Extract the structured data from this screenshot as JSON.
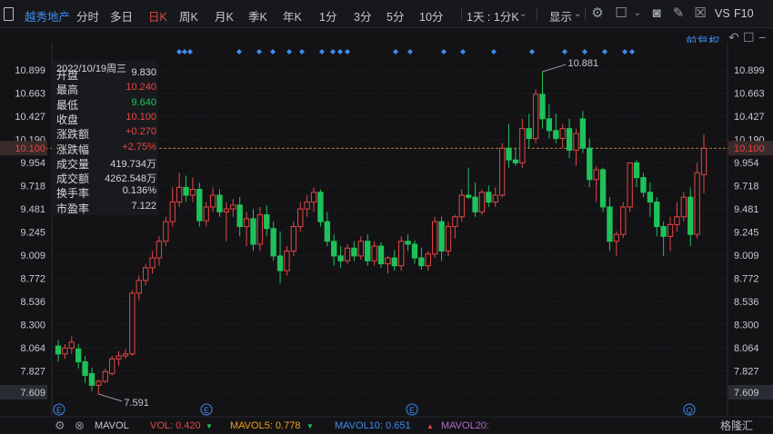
{
  "toolbar": {
    "stock_name": "越秀地产",
    "periods": [
      "分时",
      "多日",
      "日K",
      "周K",
      "月K",
      "季K",
      "年K",
      "1分",
      "3分",
      "5分",
      "10分"
    ],
    "active_period": "日K",
    "dual_period": "1天 : 1分K",
    "display_label": "显示",
    "vs_label": "VS",
    "f10_label": "F10"
  },
  "restore_label": "前复权",
  "info_panel": {
    "date": "2022/10/19周三",
    "rows": [
      {
        "label": "开盘",
        "value": "9.830",
        "color": "neutral"
      },
      {
        "label": "最高",
        "value": "10.240",
        "color": "up"
      },
      {
        "label": "最低",
        "value": "9.640",
        "color": "down"
      },
      {
        "label": "收盘",
        "value": "10.100",
        "color": "up"
      },
      {
        "label": "涨跌额",
        "value": "+0.270",
        "color": "up"
      },
      {
        "label": "涨跌幅",
        "value": "+2.75%",
        "color": "up"
      },
      {
        "label": "成交量",
        "value": "419.734万",
        "color": "neutral"
      },
      {
        "label": "成交额",
        "value": "4262.548万",
        "color": "neutral"
      },
      {
        "label": "换手率",
        "value": "0.136%",
        "color": "neutral"
      },
      {
        "label": "市盈率",
        "value": "7.122",
        "color": "neutral"
      }
    ]
  },
  "colors": {
    "up": "#e64545",
    "down": "#1fc25a",
    "neutral": "#d5d7dc",
    "bg": "#131316",
    "grid": "#2a2b30",
    "accent": "#3d8cf0"
  },
  "indicator_bar": {
    "name": "MAVOL",
    "vol": "VOL: 0.420",
    "mavol5": "MAVOL5: 0.778",
    "mavol10": "MAVOL10: 0.651",
    "mavol20": "MAVOL20:"
  },
  "logo_text": "格隆汇",
  "chart_data": {
    "type": "candlestick",
    "y_ticks": [
      "10.899",
      "10.663",
      "10.427",
      "10.190",
      "9.954",
      "9.718",
      "9.481",
      "9.245",
      "9.009",
      "8.772",
      "8.536",
      "8.300",
      "8.064",
      "7.827",
      "7.609"
    ],
    "ylim": [
      7.609,
      10.899
    ],
    "current_price": "10.100",
    "last_label": "10.100",
    "high_annotation": "10.881",
    "low_annotation": "7.591",
    "markers": [
      "E",
      "E",
      "E",
      "Q"
    ],
    "candles": [
      {
        "o": 8.08,
        "h": 8.14,
        "l": 7.92,
        "c": 8.0
      },
      {
        "o": 8.0,
        "h": 8.1,
        "l": 7.95,
        "c": 8.06
      },
      {
        "o": 8.06,
        "h": 8.18,
        "l": 8.0,
        "c": 8.12
      },
      {
        "o": 8.05,
        "h": 8.1,
        "l": 7.85,
        "c": 7.92
      },
      {
        "o": 7.92,
        "h": 7.98,
        "l": 7.7,
        "c": 7.78
      },
      {
        "o": 7.8,
        "h": 7.86,
        "l": 7.62,
        "c": 7.68
      },
      {
        "o": 7.68,
        "h": 7.74,
        "l": 7.591,
        "c": 7.72
      },
      {
        "o": 7.72,
        "h": 7.85,
        "l": 7.7,
        "c": 7.82
      },
      {
        "o": 7.8,
        "h": 7.98,
        "l": 7.78,
        "c": 7.95
      },
      {
        "o": 7.95,
        "h": 8.03,
        "l": 7.88,
        "c": 7.98
      },
      {
        "o": 7.98,
        "h": 8.05,
        "l": 7.95,
        "c": 8.0
      },
      {
        "o": 8.0,
        "h": 8.65,
        "l": 7.98,
        "c": 8.62
      },
      {
        "o": 8.62,
        "h": 8.8,
        "l": 8.55,
        "c": 8.75
      },
      {
        "o": 8.75,
        "h": 8.92,
        "l": 8.7,
        "c": 8.88
      },
      {
        "o": 8.88,
        "h": 9.05,
        "l": 8.82,
        "c": 8.98
      },
      {
        "o": 8.98,
        "h": 9.2,
        "l": 8.9,
        "c": 9.15
      },
      {
        "o": 9.15,
        "h": 9.4,
        "l": 9.1,
        "c": 9.35
      },
      {
        "o": 9.35,
        "h": 9.7,
        "l": 9.3,
        "c": 9.55
      },
      {
        "o": 9.55,
        "h": 9.85,
        "l": 9.5,
        "c": 9.7
      },
      {
        "o": 9.7,
        "h": 9.82,
        "l": 9.55,
        "c": 9.62
      },
      {
        "o": 9.62,
        "h": 9.8,
        "l": 9.55,
        "c": 9.68
      },
      {
        "o": 9.68,
        "h": 9.75,
        "l": 9.3,
        "c": 9.36
      },
      {
        "o": 9.36,
        "h": 9.55,
        "l": 9.3,
        "c": 9.5
      },
      {
        "o": 9.5,
        "h": 9.7,
        "l": 9.45,
        "c": 9.62
      },
      {
        "o": 9.62,
        "h": 9.68,
        "l": 9.4,
        "c": 9.45
      },
      {
        "o": 9.45,
        "h": 9.55,
        "l": 9.15,
        "c": 9.48
      },
      {
        "o": 9.48,
        "h": 9.58,
        "l": 9.4,
        "c": 9.52
      },
      {
        "o": 9.52,
        "h": 9.6,
        "l": 9.2,
        "c": 9.3
      },
      {
        "o": 9.3,
        "h": 9.45,
        "l": 9.1,
        "c": 9.38
      },
      {
        "o": 9.38,
        "h": 9.48,
        "l": 9.05,
        "c": 9.12
      },
      {
        "o": 9.12,
        "h": 9.5,
        "l": 9.05,
        "c": 9.42
      },
      {
        "o": 9.42,
        "h": 9.52,
        "l": 9.2,
        "c": 9.28
      },
      {
        "o": 9.28,
        "h": 9.35,
        "l": 8.95,
        "c": 9.0
      },
      {
        "o": 9.0,
        "h": 9.25,
        "l": 8.72,
        "c": 8.85
      },
      {
        "o": 8.85,
        "h": 9.1,
        "l": 8.8,
        "c": 9.05
      },
      {
        "o": 9.05,
        "h": 9.35,
        "l": 9.0,
        "c": 9.3
      },
      {
        "o": 9.3,
        "h": 9.55,
        "l": 9.25,
        "c": 9.48
      },
      {
        "o": 9.48,
        "h": 9.62,
        "l": 9.4,
        "c": 9.55
      },
      {
        "o": 9.55,
        "h": 9.7,
        "l": 9.45,
        "c": 9.65
      },
      {
        "o": 9.65,
        "h": 9.68,
        "l": 9.3,
        "c": 9.35
      },
      {
        "o": 9.35,
        "h": 9.45,
        "l": 9.1,
        "c": 9.15
      },
      {
        "o": 9.15,
        "h": 9.22,
        "l": 8.9,
        "c": 9.0
      },
      {
        "o": 9.0,
        "h": 9.1,
        "l": 8.88,
        "c": 8.95
      },
      {
        "o": 8.95,
        "h": 9.12,
        "l": 8.92,
        "c": 9.08
      },
      {
        "o": 9.08,
        "h": 9.15,
        "l": 8.95,
        "c": 9.0
      },
      {
        "o": 9.0,
        "h": 9.2,
        "l": 8.96,
        "c": 9.15
      },
      {
        "o": 9.15,
        "h": 9.22,
        "l": 8.9,
        "c": 8.95
      },
      {
        "o": 8.95,
        "h": 9.15,
        "l": 8.9,
        "c": 9.1
      },
      {
        "o": 9.1,
        "h": 9.14,
        "l": 8.88,
        "c": 8.92
      },
      {
        "o": 8.92,
        "h": 9.0,
        "l": 8.82,
        "c": 8.98
      },
      {
        "o": 8.98,
        "h": 9.06,
        "l": 8.85,
        "c": 8.9
      },
      {
        "o": 8.9,
        "h": 9.2,
        "l": 8.85,
        "c": 9.15
      },
      {
        "o": 9.15,
        "h": 9.22,
        "l": 9.05,
        "c": 9.12
      },
      {
        "o": 9.12,
        "h": 9.16,
        "l": 8.92,
        "c": 8.98
      },
      {
        "o": 8.98,
        "h": 9.08,
        "l": 8.86,
        "c": 8.9
      },
      {
        "o": 8.9,
        "h": 9.05,
        "l": 8.85,
        "c": 9.02
      },
      {
        "o": 9.02,
        "h": 9.4,
        "l": 8.98,
        "c": 9.35
      },
      {
        "o": 9.35,
        "h": 9.4,
        "l": 8.95,
        "c": 9.05
      },
      {
        "o": 9.05,
        "h": 9.35,
        "l": 9.0,
        "c": 9.3
      },
      {
        "o": 9.3,
        "h": 9.42,
        "l": 9.18,
        "c": 9.4
      },
      {
        "o": 9.4,
        "h": 9.68,
        "l": 9.35,
        "c": 9.62
      },
      {
        "o": 9.62,
        "h": 9.9,
        "l": 9.58,
        "c": 9.6
      },
      {
        "o": 9.6,
        "h": 9.75,
        "l": 9.4,
        "c": 9.45
      },
      {
        "o": 9.45,
        "h": 9.68,
        "l": 9.42,
        "c": 9.65
      },
      {
        "o": 9.65,
        "h": 9.72,
        "l": 9.5,
        "c": 9.55
      },
      {
        "o": 9.55,
        "h": 9.7,
        "l": 9.5,
        "c": 9.62
      },
      {
        "o": 9.62,
        "h": 10.15,
        "l": 9.6,
        "c": 10.1
      },
      {
        "o": 10.1,
        "h": 10.35,
        "l": 9.9,
        "c": 9.98
      },
      {
        "o": 9.98,
        "h": 10.1,
        "l": 9.92,
        "c": 9.95
      },
      {
        "o": 9.95,
        "h": 10.4,
        "l": 9.9,
        "c": 10.3
      },
      {
        "o": 10.3,
        "h": 10.45,
        "l": 10.1,
        "c": 10.2
      },
      {
        "o": 10.2,
        "h": 10.7,
        "l": 10.15,
        "c": 10.65
      },
      {
        "o": 10.65,
        "h": 10.881,
        "l": 10.3,
        "c": 10.4
      },
      {
        "o": 10.4,
        "h": 10.55,
        "l": 10.2,
        "c": 10.28
      },
      {
        "o": 10.28,
        "h": 10.45,
        "l": 10.15,
        "c": 10.2
      },
      {
        "o": 10.2,
        "h": 10.35,
        "l": 10.1,
        "c": 10.3
      },
      {
        "o": 10.3,
        "h": 10.4,
        "l": 10.0,
        "c": 10.08
      },
      {
        "o": 10.08,
        "h": 10.3,
        "l": 9.92,
        "c": 10.25
      },
      {
        "o": 10.4,
        "h": 10.48,
        "l": 10.05,
        "c": 10.1
      },
      {
        "o": 10.1,
        "h": 10.2,
        "l": 9.7,
        "c": 9.78
      },
      {
        "o": 9.78,
        "h": 9.92,
        "l": 9.55,
        "c": 9.88
      },
      {
        "o": 9.88,
        "h": 9.9,
        "l": 9.45,
        "c": 9.5
      },
      {
        "o": 9.5,
        "h": 9.6,
        "l": 9.05,
        "c": 9.15
      },
      {
        "o": 9.15,
        "h": 9.25,
        "l": 9.0,
        "c": 9.22
      },
      {
        "o": 9.22,
        "h": 9.55,
        "l": 9.18,
        "c": 9.5
      },
      {
        "o": 9.5,
        "h": 9.95,
        "l": 9.45,
        "c": 9.95
      },
      {
        "o": 9.95,
        "h": 9.98,
        "l": 9.7,
        "c": 9.8
      },
      {
        "o": 9.8,
        "h": 9.85,
        "l": 9.6,
        "c": 9.65
      },
      {
        "o": 9.65,
        "h": 9.75,
        "l": 9.4,
        "c": 9.55
      },
      {
        "o": 9.55,
        "h": 9.6,
        "l": 9.2,
        "c": 9.3
      },
      {
        "o": 9.3,
        "h": 9.35,
        "l": 9.0,
        "c": 9.2
      },
      {
        "o": 9.2,
        "h": 9.4,
        "l": 9.05,
        "c": 9.32
      },
      {
        "o": 9.32,
        "h": 9.55,
        "l": 9.25,
        "c": 9.4
      },
      {
        "o": 9.4,
        "h": 9.65,
        "l": 9.35,
        "c": 9.6
      },
      {
        "o": 9.6,
        "h": 9.7,
        "l": 9.1,
        "c": 9.22
      },
      {
        "o": 9.22,
        "h": 9.95,
        "l": 9.18,
        "c": 9.85
      },
      {
        "o": 9.83,
        "h": 10.24,
        "l": 9.64,
        "c": 10.1
      }
    ]
  }
}
